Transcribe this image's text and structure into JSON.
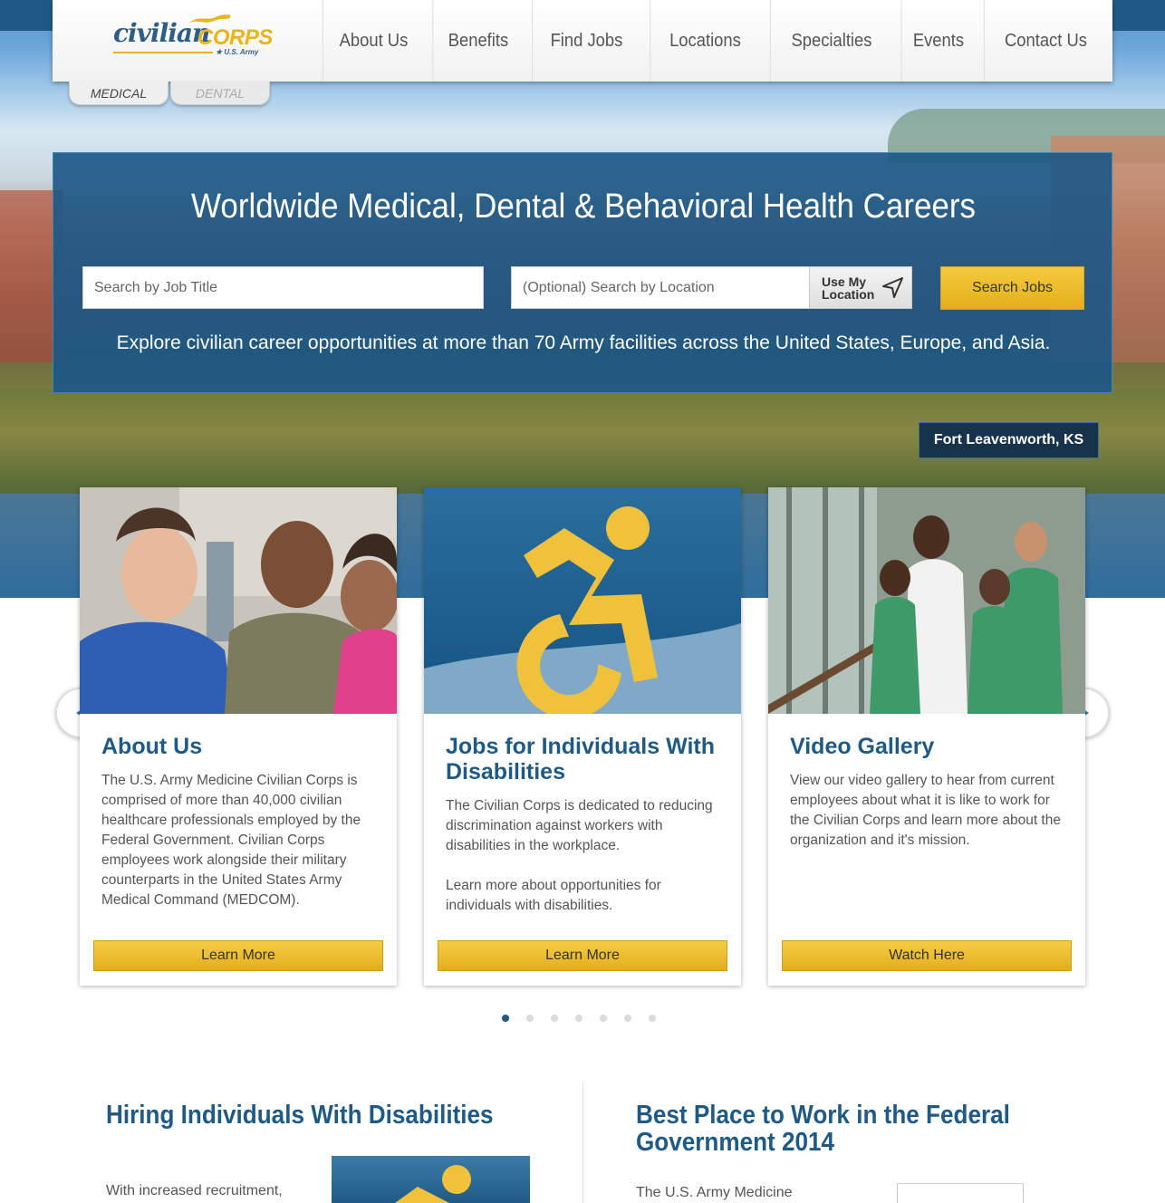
{
  "brand": {
    "word": "civilian",
    "corps": "CORPS",
    "sub": "★ U.S. Army"
  },
  "nav": [
    "About Us",
    "Benefits",
    "Find Jobs",
    "Locations",
    "Specialties",
    "Events",
    "Contact Us"
  ],
  "tabs": [
    "MEDICAL",
    "DENTAL"
  ],
  "hero": {
    "title": "Worldwide Medical, Dental & Behavioral Health Careers",
    "job_placeholder": "Search by Job Title",
    "location_placeholder": "(Optional) Search by Location",
    "use_location_label": "Use My Location",
    "search_button": "Search Jobs",
    "subtitle": "Explore civilian career opportunities at more than 70 Army facilities across the United States, Europe, and Asia.",
    "location_badge": "Fort Leavenworth, KS"
  },
  "cards": [
    {
      "title": "About Us",
      "text": "The U.S. Army Medicine Civilian Corps is comprised of more than 40,000 civilian healthcare professionals employed by the Federal Government. Civilian Corps employees work alongside their military counterparts in the United States Army Medical Command (MEDCOM).",
      "button": "Learn More"
    },
    {
      "title": "Jobs for Individuals With Disabilities",
      "text": "The Civilian Corps is dedicated to reducing discrimination against workers with disabilities in the workplace.\n\nLearn more about opportunities for individuals with disabilities.",
      "button": "Learn More"
    },
    {
      "title": "Video Gallery",
      "text": "View our video gallery to hear from current employees about what it is like to work for the Civilian Corps and learn more about the organization and it's mission.",
      "button": "Watch Here"
    }
  ],
  "carousel": {
    "dot_count": 7,
    "active_index": 0
  },
  "bottom": {
    "left_title": "Hiring Individuals With Disabilities",
    "left_text": "With increased recruitment,",
    "right_title": "Best Place to Work in the Federal Government 2014",
    "right_text": "The U.S. Army Medicine"
  },
  "colors": {
    "navy": "#1f5a86",
    "gold": "#e7b41c",
    "badge": "#16334a"
  },
  "icons": [
    "location-arrow-icon",
    "accessibility-icon",
    "chevron-left-icon",
    "chevron-right-icon"
  ]
}
